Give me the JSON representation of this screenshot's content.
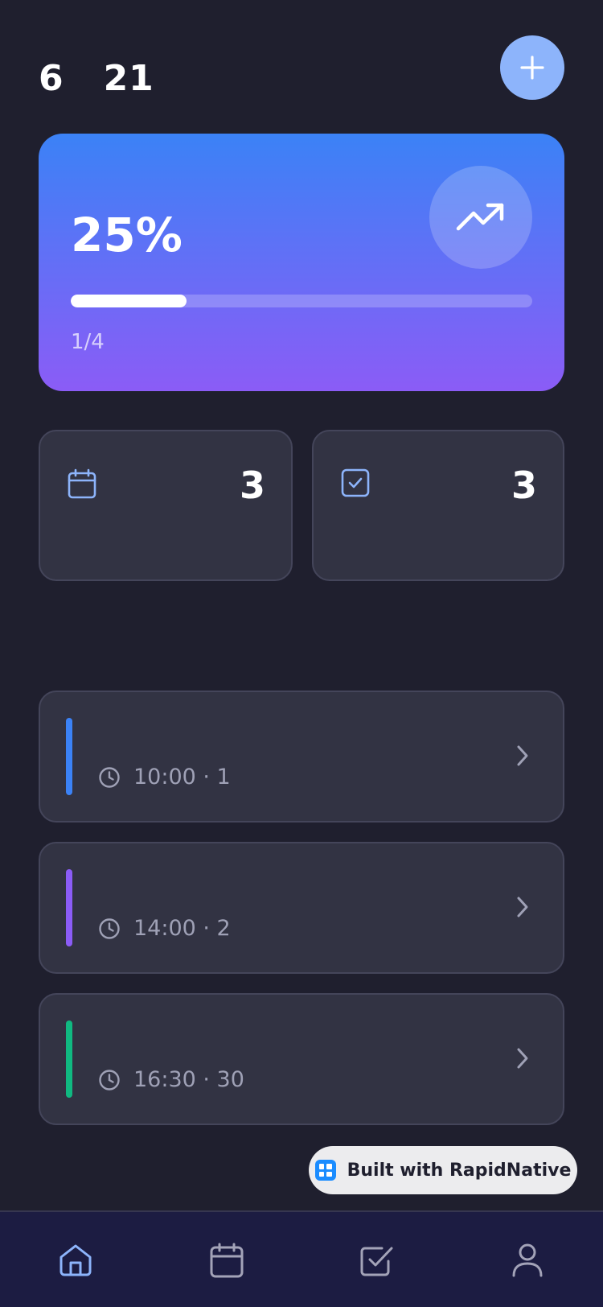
{
  "header": {
    "date_text": "6   21"
  },
  "colors": {
    "background": "#1f1f2e",
    "accent": "#8db4fb",
    "card": "#323343",
    "gradient_start": "#3b82f6",
    "gradient_end": "#8b5cf6"
  },
  "progress": {
    "percent_label": "25%",
    "fraction": 0.25,
    "count_label": "1/4",
    "icon": "trending-up-icon"
  },
  "stats": [
    {
      "icon": "calendar-icon",
      "value": "3"
    },
    {
      "icon": "checkbox-icon",
      "value": "3"
    }
  ],
  "events": [
    {
      "meta": "10:00 · 1",
      "color": "#3b82f6"
    },
    {
      "meta": "14:00 · 2",
      "color": "#8b5cf6"
    },
    {
      "meta": "16:30 · 30",
      "color": "#10b981"
    }
  ],
  "badge": {
    "label": "Built with RapidNative"
  },
  "tabs": [
    {
      "icon": "home-icon",
      "active": true
    },
    {
      "icon": "calendar-icon",
      "active": false
    },
    {
      "icon": "checkbox-icon",
      "active": false
    },
    {
      "icon": "user-icon",
      "active": false
    }
  ]
}
